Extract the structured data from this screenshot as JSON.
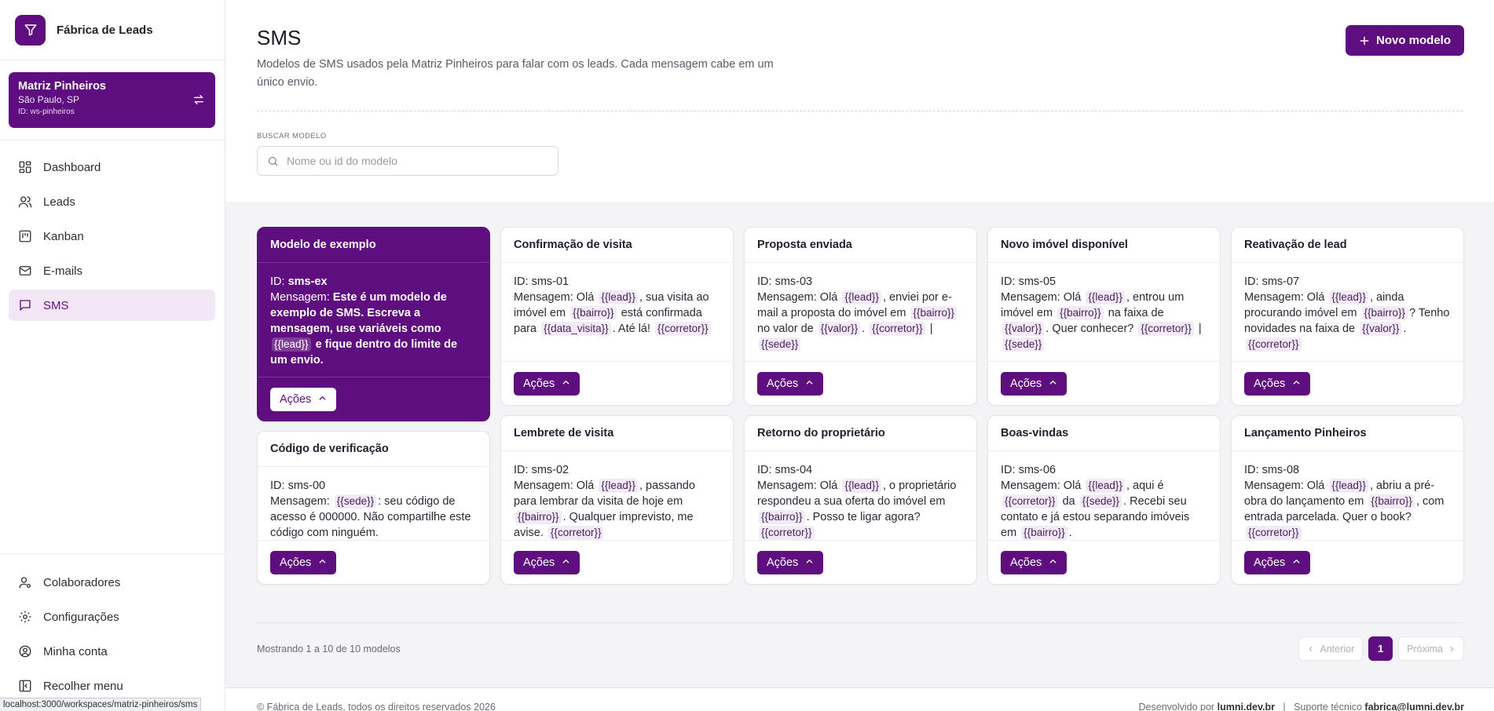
{
  "brand": {
    "name": "Fábrica de Leads"
  },
  "workspace": {
    "name": "Matriz Pinheiros",
    "location": "São Paulo, SP",
    "id_label": "ID: ws-pinheiros"
  },
  "nav": {
    "items": [
      {
        "label": "Dashboard",
        "icon": "dashboard-icon"
      },
      {
        "label": "Leads",
        "icon": "users-icon"
      },
      {
        "label": "Kanban",
        "icon": "kanban-icon"
      },
      {
        "label": "E-mails",
        "icon": "mail-icon"
      },
      {
        "label": "SMS",
        "icon": "message-icon",
        "active": true
      }
    ],
    "bottom": [
      {
        "label": "Colaboradores",
        "icon": "user-cog-icon"
      },
      {
        "label": "Configurações",
        "icon": "gear-icon"
      },
      {
        "label": "Minha conta",
        "icon": "user-circle-icon"
      },
      {
        "label": "Recolher menu",
        "icon": "collapse-icon"
      }
    ]
  },
  "header": {
    "title": "SMS",
    "subtitle": "Modelos de SMS usados pela Matriz Pinheiros para falar com os leads. Cada mensagem cabe em um único envio.",
    "new_button": "Novo modelo"
  },
  "search": {
    "label": "BUSCAR MODELO",
    "placeholder": "Nome ou id do modelo"
  },
  "card_labels": {
    "id_prefix": "ID:",
    "msg_prefix": "Mensagem:",
    "actions": "Ações"
  },
  "cards": [
    {
      "title": "Modelo de exemplo",
      "id": "sms-ex",
      "featured": true,
      "parts": [
        [
          "t",
          "Este é um modelo de exemplo de SMS. Escreva a mensagem, use variáveis como "
        ],
        [
          "v",
          "{{lead}}"
        ],
        [
          "t",
          " e fique dentro do limite de um envio."
        ]
      ]
    },
    {
      "title": "Código de verificação",
      "id": "sms-00",
      "parts": [
        [
          "v",
          "{{sede}}"
        ],
        [
          "t",
          ": seu código de acesso é 000000. Não compartilhe este código com ninguém."
        ]
      ]
    },
    {
      "title": "Confirmação de visita",
      "id": "sms-01",
      "parts": [
        [
          "t",
          "Olá "
        ],
        [
          "v",
          "{{lead}}"
        ],
        [
          "t",
          ", sua visita ao imóvel em "
        ],
        [
          "v",
          "{{bairro}}"
        ],
        [
          "t",
          " está confirmada para "
        ],
        [
          "v",
          "{{data_visita}}"
        ],
        [
          "t",
          ". Até lá! "
        ],
        [
          "v",
          "{{corretor}}"
        ]
      ]
    },
    {
      "title": "Lembrete de visita",
      "id": "sms-02",
      "parts": [
        [
          "t",
          "Olá "
        ],
        [
          "v",
          "{{lead}}"
        ],
        [
          "t",
          ", passando para lembrar da visita de hoje em "
        ],
        [
          "v",
          "{{bairro}}"
        ],
        [
          "t",
          ". Qualquer imprevisto, me avise. "
        ],
        [
          "v",
          "{{corretor}}"
        ]
      ]
    },
    {
      "title": "Proposta enviada",
      "id": "sms-03",
      "parts": [
        [
          "t",
          "Olá "
        ],
        [
          "v",
          "{{lead}}"
        ],
        [
          "t",
          ", enviei por e-mail a proposta do imóvel em "
        ],
        [
          "v",
          "{{bairro}}"
        ],
        [
          "t",
          " no valor de "
        ],
        [
          "v",
          "{{valor}}"
        ],
        [
          "t",
          ". "
        ],
        [
          "v",
          "{{corretor}}"
        ],
        [
          "p",
          "|"
        ],
        [
          "v",
          "{{sede}}"
        ]
      ]
    },
    {
      "title": "Retorno do proprietário",
      "id": "sms-04",
      "parts": [
        [
          "t",
          "Olá "
        ],
        [
          "v",
          "{{lead}}"
        ],
        [
          "t",
          ", o proprietário respondeu a sua oferta do imóvel em "
        ],
        [
          "v",
          "{{bairro}}"
        ],
        [
          "t",
          ". Posso te ligar agora? "
        ],
        [
          "v",
          "{{corretor}}"
        ]
      ]
    },
    {
      "title": "Novo imóvel disponível",
      "id": "sms-05",
      "parts": [
        [
          "t",
          "Olá "
        ],
        [
          "v",
          "{{lead}}"
        ],
        [
          "t",
          ", entrou um imóvel em "
        ],
        [
          "v",
          "{{bairro}}"
        ],
        [
          "t",
          " na faixa de "
        ],
        [
          "v",
          "{{valor}}"
        ],
        [
          "t",
          ". Quer conhecer? "
        ],
        [
          "v",
          "{{corretor}}"
        ],
        [
          "p",
          "|"
        ],
        [
          "v",
          "{{sede}}"
        ]
      ]
    },
    {
      "title": "Boas-vindas",
      "id": "sms-06",
      "parts": [
        [
          "t",
          "Olá "
        ],
        [
          "v",
          "{{lead}}"
        ],
        [
          "t",
          ", aqui é "
        ],
        [
          "v",
          "{{corretor}}"
        ],
        [
          "t",
          " da "
        ],
        [
          "v",
          "{{sede}}"
        ],
        [
          "t",
          ". Recebi seu contato e já estou separando imóveis em "
        ],
        [
          "v",
          "{{bairro}}"
        ],
        [
          "t",
          "."
        ]
      ]
    },
    {
      "title": "Reativação de lead",
      "id": "sms-07",
      "parts": [
        [
          "t",
          "Olá "
        ],
        [
          "v",
          "{{lead}}"
        ],
        [
          "t",
          ", ainda procurando imóvel em "
        ],
        [
          "v",
          "{{bairro}}"
        ],
        [
          "t",
          "? Tenho novidades na faixa de "
        ],
        [
          "v",
          "{{valor}}"
        ],
        [
          "t",
          ". "
        ],
        [
          "v",
          "{{corretor}}"
        ]
      ]
    },
    {
      "title": "Lançamento Pinheiros",
      "id": "sms-08",
      "parts": [
        [
          "t",
          "Olá "
        ],
        [
          "v",
          "{{lead}}"
        ],
        [
          "t",
          ", abriu a pré-obra do lançamento em "
        ],
        [
          "v",
          "{{bairro}}"
        ],
        [
          "t",
          ", com entrada parcelada. Quer o book? "
        ],
        [
          "v",
          "{{corretor}}"
        ]
      ]
    }
  ],
  "pagination": {
    "summary": "Mostrando 1 a 10 de 10 modelos",
    "prev": "Anterior",
    "current": "1",
    "next": "Próxima"
  },
  "footer": {
    "copyright": "© Fábrica de Leads, todos os direitos reservados 2026",
    "dev_prefix": "Desenvolvido por",
    "dev_name": "lumni.dev.br",
    "support_prefix": "Suporte técnico",
    "support_email": "fabrica@lumni.dev.br"
  },
  "status_url": "localhost:3000/workspaces/matriz-pinheiros/sms",
  "colors": {
    "accent": "#5e0e7e",
    "accent_light": "#f3e6f7"
  }
}
